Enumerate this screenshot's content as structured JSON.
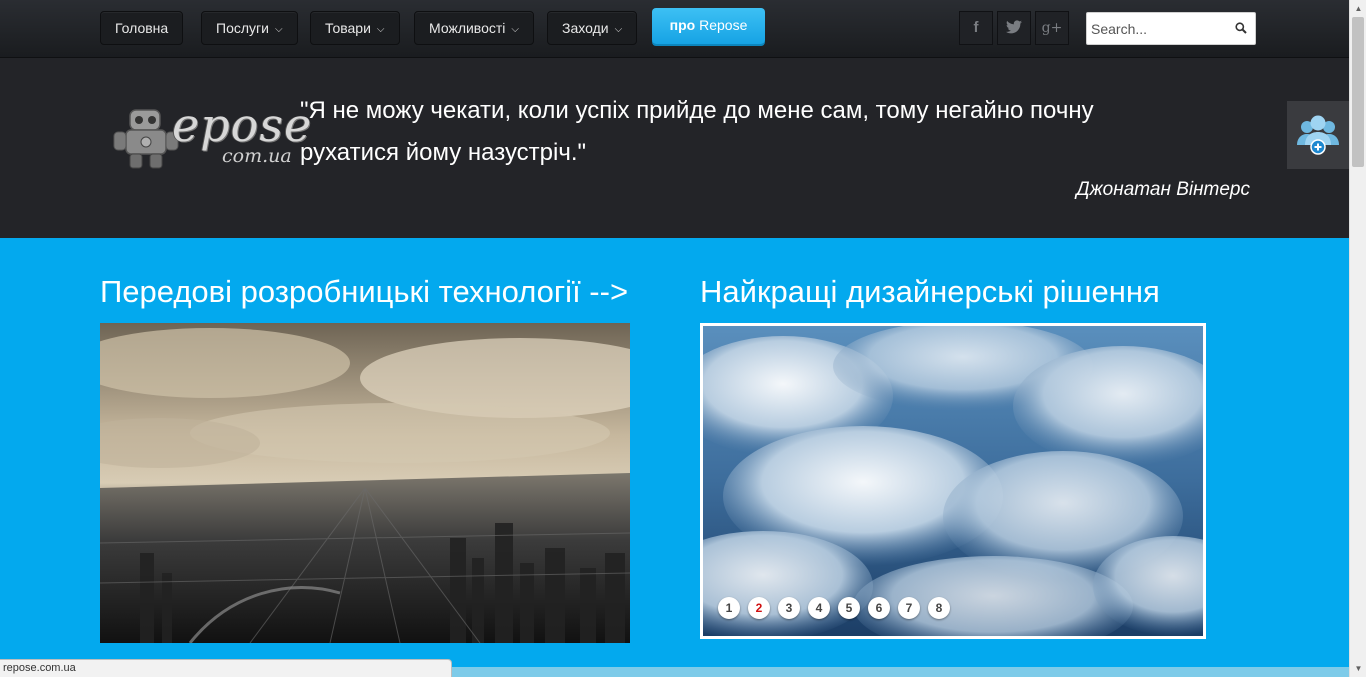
{
  "nav": {
    "items": [
      {
        "label": "Головна",
        "dropdown": false
      },
      {
        "label": "Послуги",
        "dropdown": true
      },
      {
        "label": "Товари",
        "dropdown": true
      },
      {
        "label": "Можливості",
        "dropdown": true
      },
      {
        "label": "Заходи",
        "dropdown": true
      }
    ],
    "about": {
      "prefix": "про",
      "name": "Repose"
    },
    "social": [
      {
        "icon": "facebook-icon",
        "glyph": "f"
      },
      {
        "icon": "twitter-icon",
        "glyph": "t"
      },
      {
        "icon": "google-plus-icon",
        "glyph": "g+"
      }
    ],
    "search_placeholder": "Search..."
  },
  "hero": {
    "logo_text": "epose",
    "logo_sub": "com.ua",
    "quote": "\"Я не можу чекати, коли успіх прийде до мене сам, тому негайно почну рухатися йому назустріч.\"",
    "author": "Джонатан Вінтерс"
  },
  "sections": [
    {
      "title": "Передові розробницькі технології -->"
    },
    {
      "title": "Найкращі дизайнерські рішення"
    }
  ],
  "slider": {
    "pages": [
      "1",
      "2",
      "3",
      "4",
      "5",
      "6",
      "7",
      "8"
    ],
    "active": 2
  },
  "status_bar": {
    "url": "repose.com.ua"
  },
  "colors": {
    "accent": "#03a9ee",
    "dark_header": "#232428",
    "about_button": "#2bb5ef",
    "active_dot": "#d01010"
  }
}
